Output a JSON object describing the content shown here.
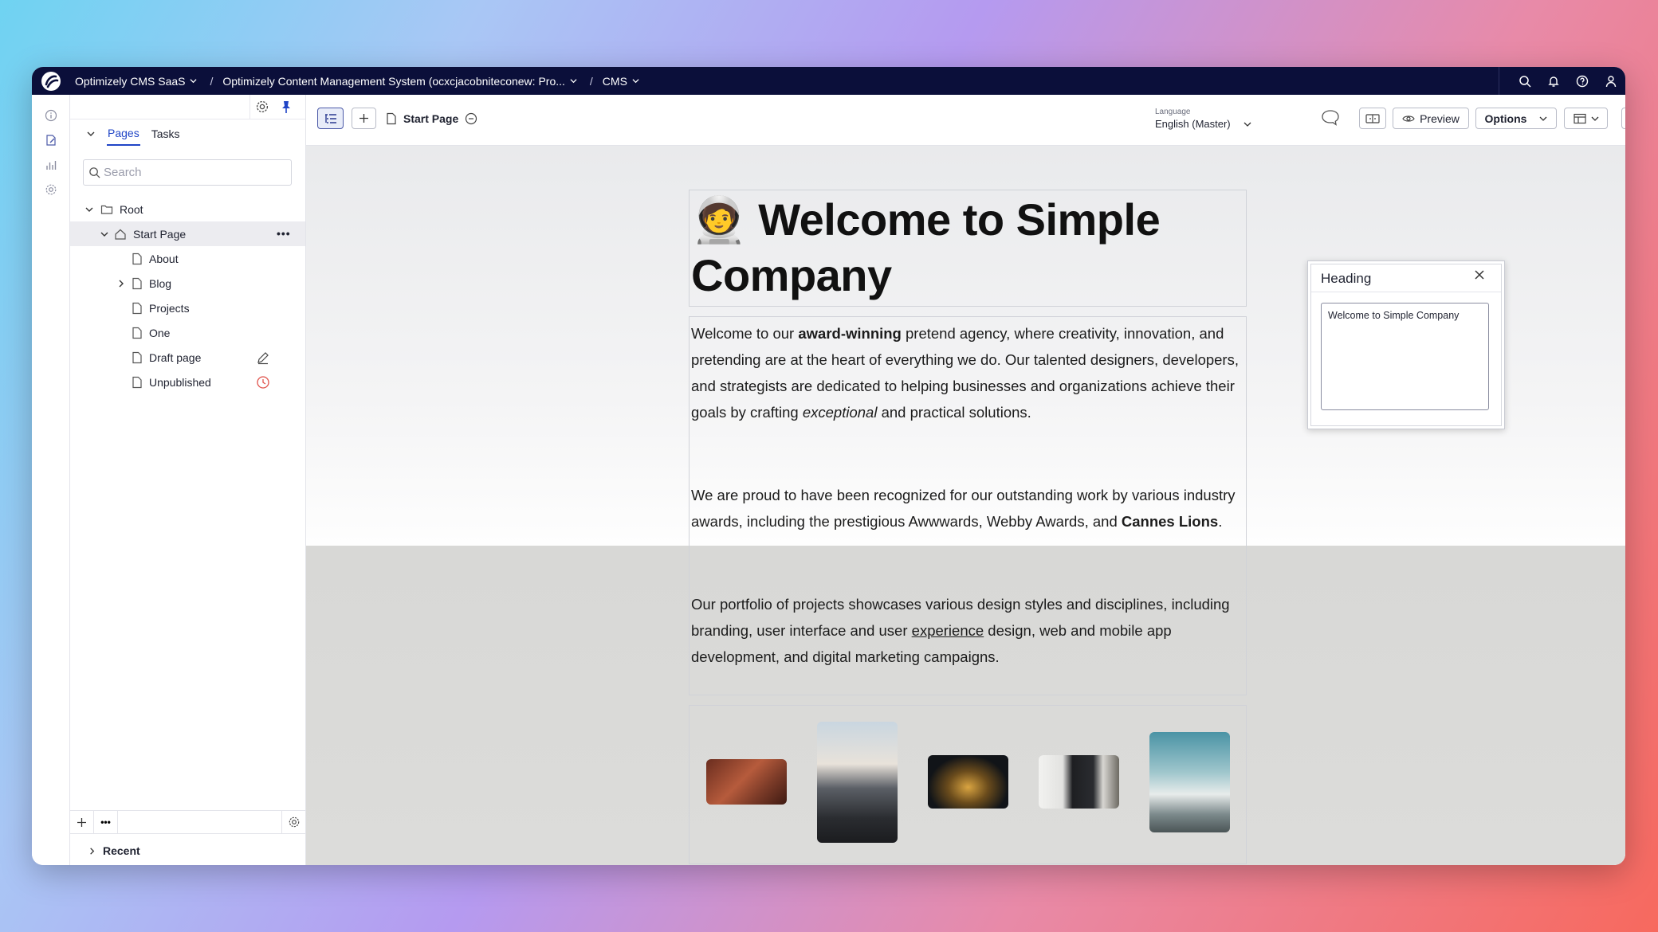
{
  "topbar": {
    "product": "Optimizely CMS SaaS",
    "instance": "Optimizely Content Management System (ocxcjacobniteconew: Pro...",
    "app": "CMS"
  },
  "nav": {
    "tabs": [
      "Pages",
      "Tasks"
    ],
    "search_placeholder": "Search",
    "tree": {
      "root": "Root",
      "start_page": "Start Page",
      "children": [
        "About",
        "Blog",
        "Projects",
        "One",
        "Draft page",
        "Unpublished"
      ]
    },
    "recent": "Recent"
  },
  "toolbar": {
    "page_name": "Start Page",
    "language_caption": "Language",
    "language_value": "English (Master)",
    "preview_label": "Preview",
    "options_label": "Options"
  },
  "content": {
    "heading_emoji": "🧑‍🚀",
    "heading": "Welcome to Simple Company",
    "p1": {
      "a": "Welcome to our ",
      "b_bold": "award-winning",
      "c": " pretend agency, where creativity, innovation, and pretending are at the heart of everything we do. Our talented designers, developers, and strategists are dedicated to helping businesses and organizations achieve their goals by crafting ",
      "d_italic": "exceptional",
      "e": " and practical solutions."
    },
    "p2": {
      "a": "We are proud to have been recognized for our outstanding work by various industry awards, including the prestigious Awwwards, Webby Awards, and ",
      "b_bold": "Cannes Lions",
      "c": "."
    },
    "p3": {
      "a": "Our portfolio of projects showcases various design styles and disciplines, including branding, user interface and user ",
      "b_link": "experience",
      "c": " design, web and mobile app development, and digital marketing campaigns."
    }
  },
  "popup": {
    "title": "Heading",
    "value": "Welcome to Simple Company"
  },
  "colors": {
    "topbar": "#0b0f3a",
    "accent": "#1f44c6",
    "unpublished_status": "#e0524b"
  },
  "icons": [
    "optimizely-logo-icon",
    "search-icon",
    "bell-icon",
    "help-icon",
    "user-icon",
    "gear-icon",
    "pin-icon",
    "folder-icon",
    "home-icon",
    "page-icon",
    "pencil-icon",
    "clock-icon",
    "tree-view-icon",
    "plus-icon",
    "comment-icon",
    "eye-icon",
    "layout-icon",
    "compare-icon",
    "close-icon"
  ]
}
